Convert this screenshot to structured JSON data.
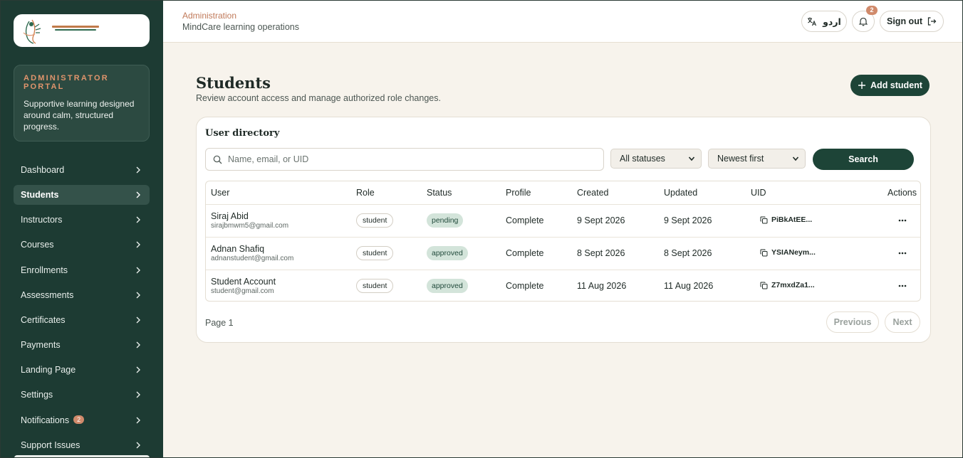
{
  "sidebar": {
    "logo_alt": "MindCare Wellness Centre",
    "portal_label": "ADMINISTRATOR PORTAL",
    "portal_desc": "Supportive learning designed around calm, structured progress.",
    "items": [
      {
        "label": "Dashboard",
        "active": false
      },
      {
        "label": "Students",
        "active": true
      },
      {
        "label": "Instructors",
        "active": false
      },
      {
        "label": "Courses",
        "active": false
      },
      {
        "label": "Enrollments",
        "active": false
      },
      {
        "label": "Assessments",
        "active": false
      },
      {
        "label": "Certificates",
        "active": false
      },
      {
        "label": "Payments",
        "active": false
      },
      {
        "label": "Landing Page",
        "active": false
      },
      {
        "label": "Settings",
        "active": false
      },
      {
        "label": "Notifications",
        "active": false,
        "badge": "2"
      },
      {
        "label": "Support Issues",
        "active": false
      }
    ]
  },
  "header": {
    "crumb": "Administration",
    "subtitle": "MindCare learning operations",
    "language_label": "اردو",
    "notification_count": "2",
    "signout_label": "Sign out"
  },
  "main": {
    "title": "Students",
    "subtitle": "Review account access and manage authorized role changes.",
    "add_label": "Add student",
    "directory_title": "User directory",
    "search_placeholder": "Name, email, or UID",
    "status_filter": "All statuses",
    "sort": "Newest first",
    "search_label": "Search",
    "columns": [
      "User",
      "Role",
      "Status",
      "Profile",
      "Created",
      "Updated",
      "UID",
      "Actions"
    ],
    "rows": [
      {
        "name": "Siraj Abid",
        "email": "sirajbmwm5@gmail.com",
        "role": "student",
        "status": "pending",
        "profile": "Complete",
        "created": "9 Sept 2026",
        "updated": "9 Sept 2026",
        "uid": "PiBkAtEE..."
      },
      {
        "name": "Adnan Shafiq",
        "email": "adnanstudent@gmail.com",
        "role": "student",
        "status": "approved",
        "profile": "Complete",
        "created": "8 Sept 2026",
        "updated": "8 Sept 2026",
        "uid": "YSIANeym..."
      },
      {
        "name": "Student Account",
        "email": "student@gmail.com",
        "role": "student",
        "status": "approved",
        "profile": "Complete",
        "created": "11 Aug 2026",
        "updated": "11 Aug 2026",
        "uid": "Z7mxdZa1..."
      }
    ],
    "page_label": "Page 1",
    "previous_label": "Previous",
    "next_label": "Next"
  },
  "colors": {
    "sidebar_bg": "#1d3b33",
    "accent": "#1d4437",
    "brand_orange": "#d08a6b",
    "page_bg": "#f7f3ec"
  }
}
